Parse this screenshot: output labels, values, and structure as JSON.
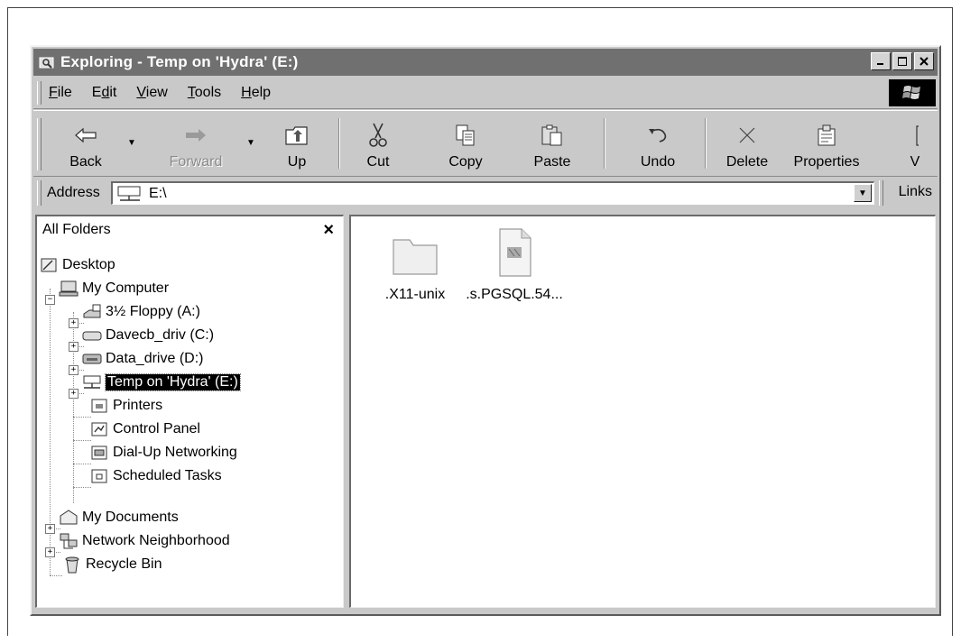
{
  "window": {
    "title": "Exploring - Temp on 'Hydra' (E:)",
    "controls": [
      "minimize",
      "maximize",
      "close"
    ]
  },
  "menu": {
    "file": {
      "mnemonic": "F",
      "rest": "ile"
    },
    "edit": {
      "pre": "E",
      "mnemonic": "d",
      "rest": "it"
    },
    "view": {
      "mnemonic": "V",
      "rest": "iew"
    },
    "tools": {
      "mnemonic": "T",
      "rest": "ools"
    },
    "help": {
      "mnemonic": "H",
      "rest": "elp"
    }
  },
  "toolbar": {
    "back": "Back",
    "forward": "Forward",
    "up": "Up",
    "cut": "Cut",
    "copy": "Copy",
    "paste": "Paste",
    "undo": "Undo",
    "delete": "Delete",
    "properties": "Properties",
    "views": "V"
  },
  "address": {
    "label": "Address",
    "value": "E:\\",
    "links": "Links"
  },
  "folders": {
    "header": "All Folders",
    "close": "×",
    "tree": {
      "desktop": "Desktop",
      "my_computer": "My Computer",
      "floppy": "3½ Floppy (A:)",
      "drive_c": "Davecb_driv (C:)",
      "drive_d": "Data_drive (D:)",
      "drive_e": "Temp on 'Hydra' (E:)",
      "printers": "Printers",
      "control_panel": "Control Panel",
      "dialup": "Dial-Up Networking",
      "tasks": "Scheduled Tasks",
      "my_documents": "My Documents",
      "network": "Network Neighborhood",
      "recycle": "Recycle Bin"
    }
  },
  "files": [
    {
      "name": ".X11-unix",
      "icon": "folder-icon"
    },
    {
      "name": ".s.PGSQL.54...",
      "icon": "file-icon"
    }
  ]
}
